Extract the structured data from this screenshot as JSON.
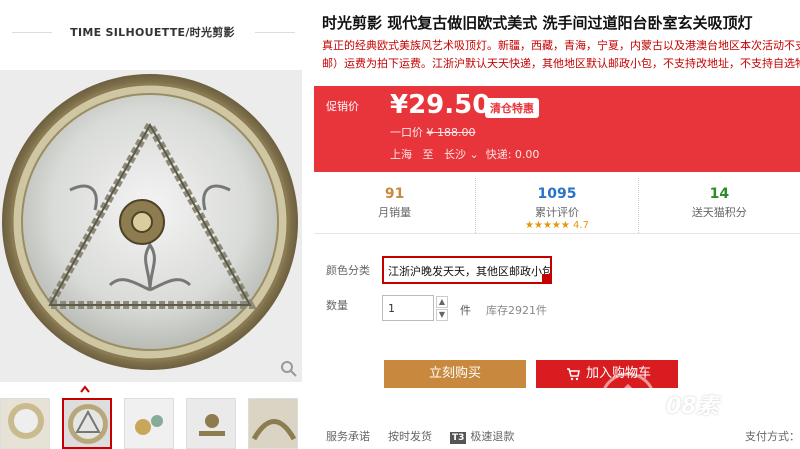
{
  "store": {
    "name": "TIME SILHOUETTE/时光剪影"
  },
  "product": {
    "title": "时光剪影 现代复古做旧欧式美式 洗手间过道阳台卧室玄关吸顶灯",
    "subtitle_line1": "真正的经典欧式美族风艺术吸顶灯。新疆，西藏，青海，宁夏，内蒙古以及港澳台地区本次活动不支持包",
    "subtitle_line2": "邮）运费为拍下运费。江浙沪默认天天快递，其他地区默认邮政小包，不支持改地址，不支持自选物流"
  },
  "price": {
    "promo_label": "促销价",
    "promo_value": "¥29.50",
    "badge": "清仓特惠",
    "orig_label": "一口价",
    "orig_value": "¥ 188.00",
    "ship_from": "上海",
    "ship_to_word": "至",
    "ship_to": "长沙",
    "ship_fee": "快递: 0.00"
  },
  "stats": [
    {
      "num": "91",
      "caption": "月销量",
      "color": "#c8883e"
    },
    {
      "num": "1095",
      "caption": "累计评价",
      "color": "#2b73c5",
      "rating": "4.7",
      "stars": "★★★★★"
    },
    {
      "num": "14",
      "caption": "送天猫积分",
      "color": "#2e8b2e"
    }
  ],
  "options": {
    "color_label": "颜色分类",
    "color_value": "江浙沪晚发天天，其他区邮政小包",
    "qty_label": "数量",
    "qty_value": "1",
    "unit": "件",
    "stock": "库存2921件"
  },
  "actions": {
    "buy_now": "立刻购买",
    "add_cart": "加入购物车"
  },
  "service": {
    "label": "服务承诺",
    "on_time": "按时发货",
    "t3_badge": "T3",
    "refund": "极速退款",
    "pay": "支付方式："
  },
  "watermark": {
    "text": "08素"
  },
  "colors": {
    "accent": "#c40000",
    "price_bg": "#e8353b",
    "buy": "#c8883e",
    "cart": "#d91c1f"
  }
}
